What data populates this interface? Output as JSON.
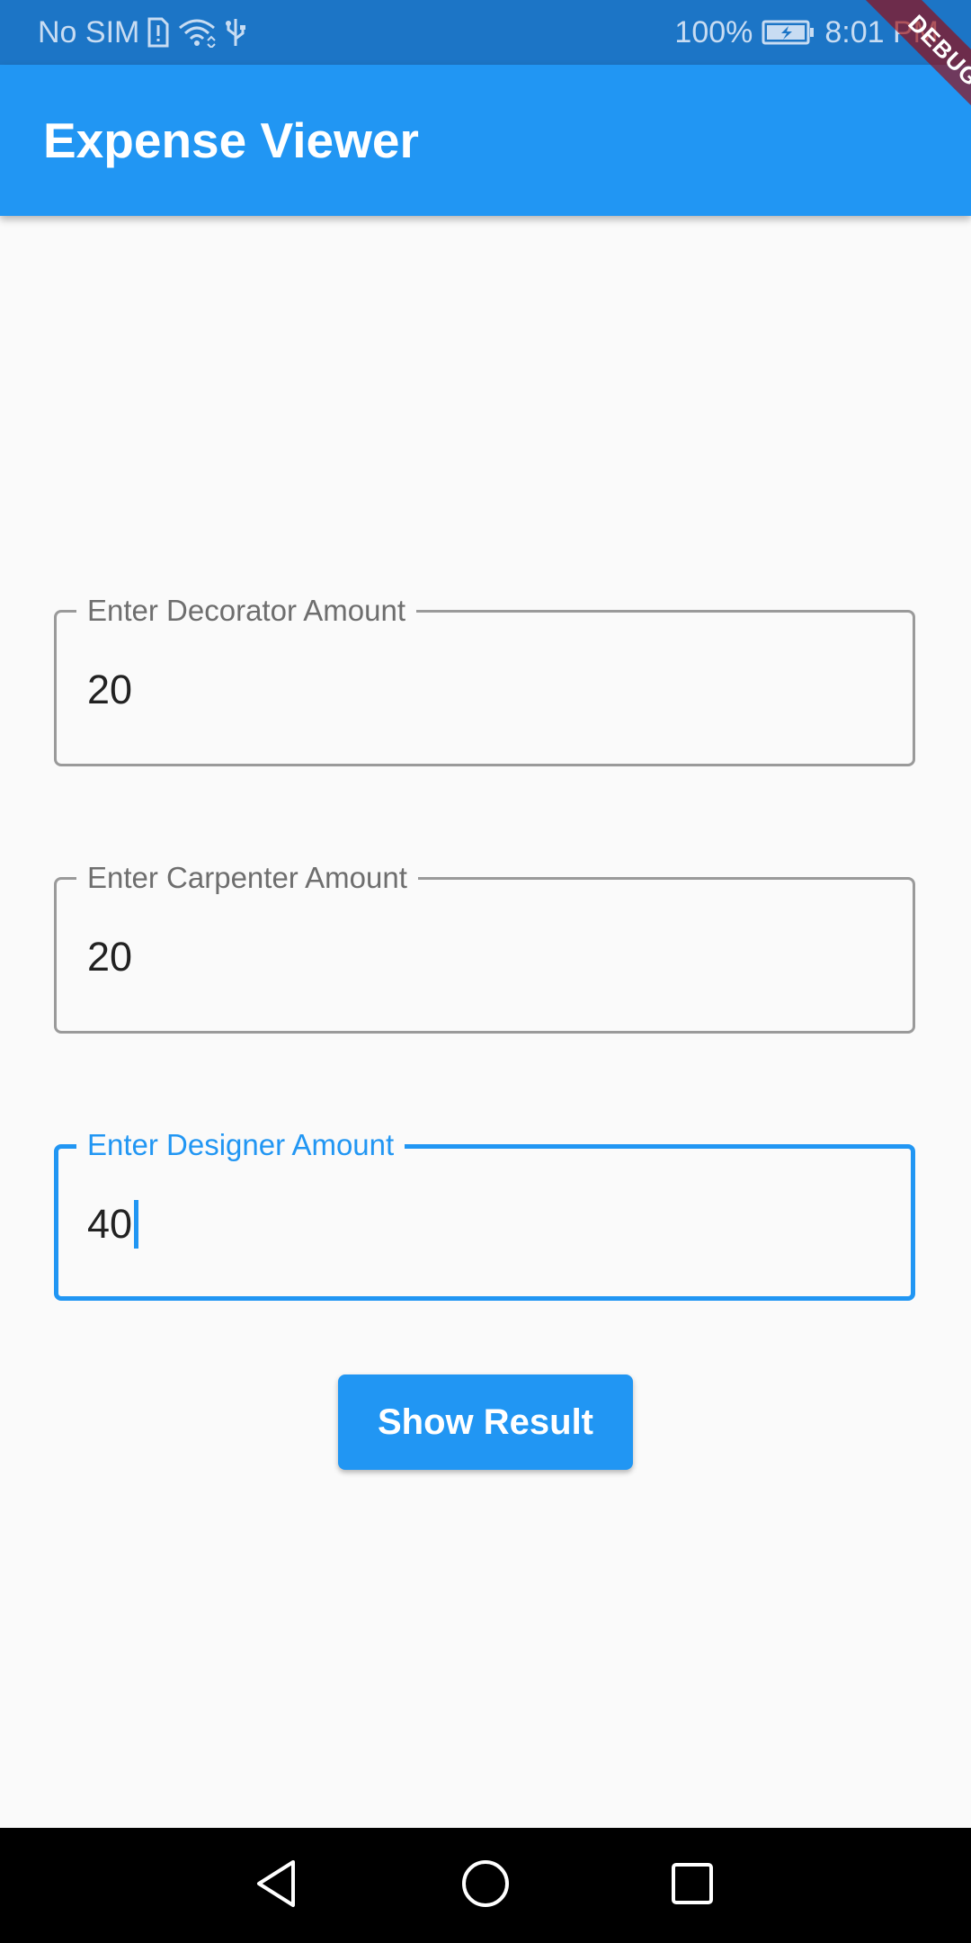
{
  "status_bar": {
    "carrier": "No SIM",
    "battery": "100%",
    "time": "8:01 PM",
    "icons": [
      "sim-alert-icon",
      "wifi-icon",
      "usb-icon",
      "battery-charging-icon"
    ]
  },
  "app_bar": {
    "title": "Expense Viewer"
  },
  "debug_banner": {
    "label": "DEBUG"
  },
  "form": {
    "fields": [
      {
        "label": "Enter Decorator Amount",
        "value": "20",
        "focused": false
      },
      {
        "label": "Enter Carpenter Amount",
        "value": "20",
        "focused": false
      },
      {
        "label": "Enter Designer Amount",
        "value": "40",
        "focused": true
      }
    ],
    "submit_label": "Show Result"
  },
  "nav_bar": {
    "icons": [
      "back-icon",
      "home-icon",
      "recents-icon"
    ]
  },
  "colors": {
    "primary": "#2196f3",
    "status_bar": "#1c75c6",
    "background": "#fafafa",
    "outline": "#9a9a9a",
    "label_text": "#6e6e6e",
    "debug_banner": "#a00000"
  }
}
